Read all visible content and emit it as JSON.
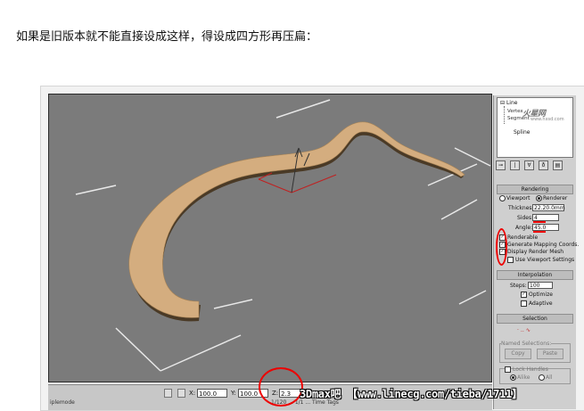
{
  "caption": "如果是旧版本就不能直接设成这样，得设成四方形再压扁：",
  "modifier_stack": {
    "root": "Line",
    "sub_items": [
      "Vertex",
      "Segment"
    ],
    "base": "Spline",
    "watermark": "火星网",
    "watermark_url": "www.hxsd.com"
  },
  "command_panel_tabs": [
    "create-icon",
    "modify-icon",
    "hierarchy-icon",
    "motion-icon",
    "display-icon",
    "utilities-icon"
  ],
  "rendering": {
    "header": "Rendering",
    "viewport_label": "Viewport",
    "renderer_label": "Renderer",
    "thickness_label": "Thickness:",
    "thickness_value": "22.20.0mm",
    "sides_label": "Sides:",
    "sides_value": "4",
    "angle_label": "Angle:",
    "angle_value": "45.0",
    "renderable_label": "Renderable",
    "renderable_checked": "✓",
    "mapping_label": "Generate Mapping Coords.",
    "mapping_checked": "✓",
    "display_mesh_label": "Display Render Mesh",
    "display_mesh_checked": "✓",
    "use_viewport_label": "Use Viewport Settings"
  },
  "interpolation": {
    "header": "Interpolation",
    "steps_label": "Steps:",
    "steps_value": "100",
    "optimize_label": "Optimize",
    "optimize_checked": "✓",
    "adaptive_label": "Adaptive"
  },
  "selection": {
    "header": "Selection",
    "named_label": "Named Selections:",
    "copy_label": "Copy",
    "paste_label": "Paste",
    "lock_label": "Lock Handles",
    "alike_label": "Alike",
    "all_label": "All"
  },
  "statusbar": {
    "x_label": "X:",
    "x_value": "100.0",
    "y_label": "Y:",
    "y_value": "100.0",
    "z_label": "Z:",
    "z_value": "2.3",
    "key_filters": "Key Filters...",
    "left_small": "iplemode",
    "bottom_small": "1/120 ... 1/1 ... Time Tags"
  },
  "banner": "3Dmax吧 【www.linecg.com/tieba/1711】",
  "colors": {
    "viewport_bg": "#7b7b7b",
    "spline_fill": "#d4ad7f",
    "highlight_red": "#e00000",
    "gizmo_red": "#c02020"
  }
}
